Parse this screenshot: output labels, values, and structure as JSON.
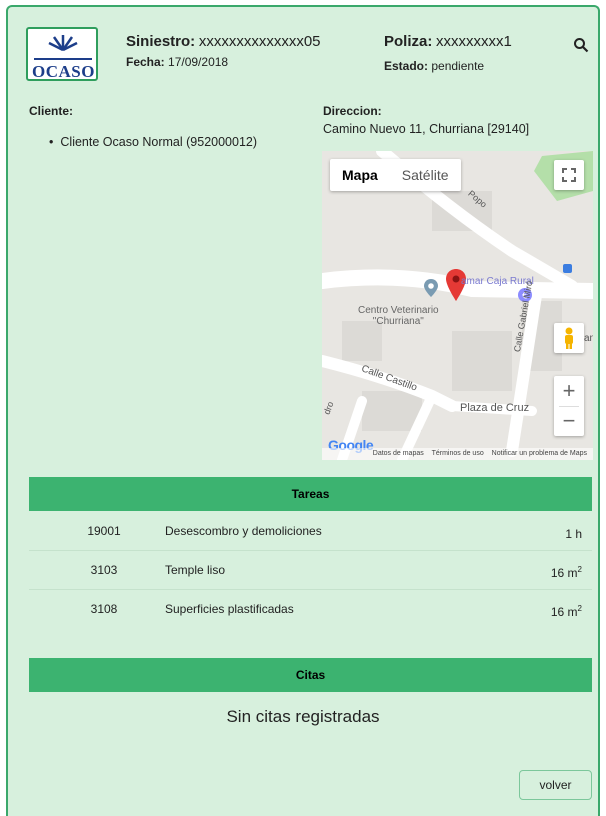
{
  "header": {
    "brand": "OCASO",
    "siniestro_label": "Siniestro:",
    "siniestro_value": "xxxxxxxxxxxxxx05",
    "fecha_label": "Fecha:",
    "fecha_value": "17/09/2018",
    "poliza_label": "Poliza:",
    "poliza_value": "xxxxxxxxx1",
    "estado_label": "Estado:",
    "estado_value": "pendiente"
  },
  "cliente": {
    "label": "Cliente:",
    "items": [
      "Cliente Ocaso Normal (952000012)"
    ]
  },
  "direccion": {
    "label": "Direccion:",
    "value": "Camino Nuevo 11, Churriana [29140]"
  },
  "map": {
    "type_buttons": [
      "Mapa",
      "Satélite"
    ],
    "active_type": "Mapa",
    "labels": {
      "poi1": "Centro Veterinario",
      "poi1b": "\"Churriana\"",
      "poi2": "amar Caja Rural",
      "street1": "Calle Castillo",
      "street2": "Calle Gabriel Miró",
      "street3": "Popo",
      "place": "Plaza de Cruz",
      "edge1": "an",
      "edge2": "dro"
    },
    "zoom_in": "+",
    "zoom_out": "−",
    "google": "Google",
    "footer": [
      "Datos de mapas",
      "Términos de uso",
      "Notificar un problema de Maps"
    ]
  },
  "tareas": {
    "title": "Tareas",
    "rows": [
      {
        "code": "19001",
        "desc": "Desescombro y demoliciones",
        "qty": "1 h",
        "sup": ""
      },
      {
        "code": "3103",
        "desc": "Temple liso",
        "qty": "16 m",
        "sup": "2"
      },
      {
        "code": "3108",
        "desc": "Superficies plastificadas",
        "qty": "16 m",
        "sup": "2"
      }
    ]
  },
  "citas": {
    "title": "Citas",
    "empty": "Sin citas registradas"
  },
  "actions": {
    "volver": "volver"
  }
}
